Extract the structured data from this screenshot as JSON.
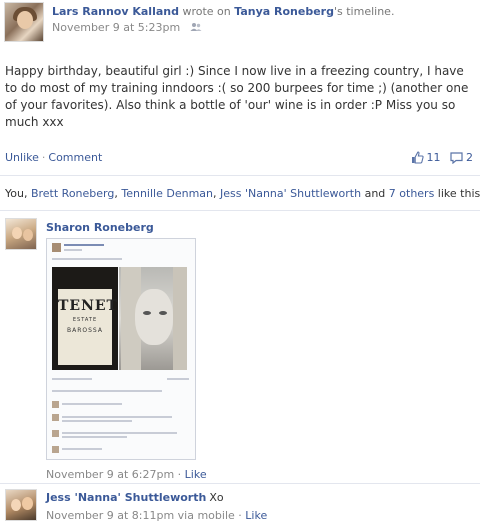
{
  "post": {
    "author": "Lars Rannov Kalland",
    "wrote_on": "wrote on",
    "target": "Tanya Roneberg",
    "target_suffix": "'s timeline.",
    "timestamp": "November 9 at 5:23pm",
    "privacy_icon": "friends-icon",
    "body": "Happy birthday, beautiful girl :) Since I now live in a freezing country, I have to do most of my training inndoors :( so 200 burpees for time ;) (another one of your favorites). Also think a bottle of 'our' wine is in order :P Miss you so much xxx"
  },
  "actions": {
    "unlike": "Unlike",
    "separator": "·",
    "comment": "Comment",
    "like_count": "11",
    "comment_count": "2"
  },
  "likes": {
    "prefix": "You, ",
    "name1": "Brett Roneberg",
    "comma1": ", ",
    "name2": "Tennille Denman",
    "comma2": ", ",
    "name3": "Jess 'Nanna' Shuttleworth",
    "and": " and ",
    "others": "7 others",
    "suffix": " like this."
  },
  "comments": [
    {
      "author": "Sharon Roneberg",
      "text": "",
      "time": "November 9 at 6:27pm",
      "sep": "·",
      "like": "Like",
      "attachment": {
        "wine_label": "TENET",
        "wine_sub": "ESTATE",
        "wine_region": "BAROSSA"
      }
    },
    {
      "author": "Jess 'Nanna' Shuttleworth",
      "text": "Xo",
      "time": "November 9 at 8:11pm via mobile",
      "sep": "·",
      "like": "Like"
    }
  ],
  "colors": {
    "link": "#3b5998",
    "meta": "#888888",
    "text": "#333333",
    "divider": "#e3e6ee"
  }
}
